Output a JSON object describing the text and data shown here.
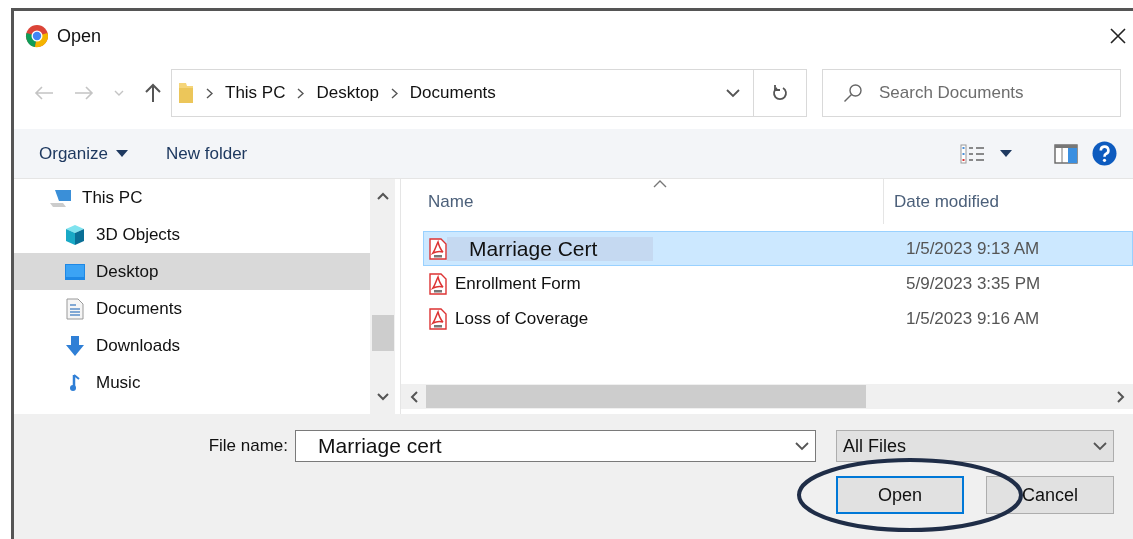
{
  "window": {
    "title": "Open"
  },
  "address": {
    "path": [
      "This PC",
      "Desktop",
      "Documents"
    ]
  },
  "search": {
    "placeholder": "Search Documents"
  },
  "toolbar": {
    "buttons": [
      {
        "label": "Organize",
        "kind": "menu"
      },
      {
        "label": "New folder",
        "kind": "plain"
      }
    ]
  },
  "sidebar": {
    "items": [
      {
        "label": "This PC",
        "selected": false,
        "children": [
          {
            "label": "3D Objects",
            "selected": false
          },
          {
            "label": "Desktop",
            "selected": true
          },
          {
            "label": "Documents",
            "selected": false
          },
          {
            "label": "Downloads",
            "selected": false
          },
          {
            "label": "Music",
            "selected": false
          }
        ]
      }
    ]
  },
  "file_list": {
    "columns": [
      "Name",
      "Date modified"
    ],
    "rows": [
      {
        "name": "Marriage Cert",
        "date": "1/5/2023 9:13 AM",
        "selected": true
      },
      {
        "name": "Enrollment Form",
        "date": "5/9/2023 3:35 PM",
        "selected": false
      },
      {
        "name": "Loss of Coverage",
        "date": "1/5/2023 9:16 AM",
        "selected": false
      }
    ]
  },
  "file_name": {
    "label": "File name:",
    "value": "Marriage cert"
  },
  "file_type": {
    "value": "All Files"
  },
  "buttons": [
    {
      "label": "Open",
      "default": true,
      "circled": true
    },
    {
      "label": "Cancel",
      "default": false,
      "circled": false
    }
  ]
}
